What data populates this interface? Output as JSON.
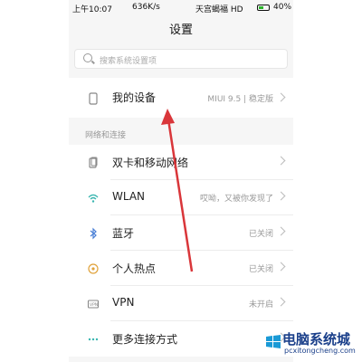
{
  "status_bar": {
    "time": "上午10:07",
    "speed": "636K/s",
    "carrier": "天宫蝎福 HD",
    "battery": "40%"
  },
  "header": {
    "title": "设置"
  },
  "search": {
    "placeholder": "搜索系统设置项"
  },
  "my_device": {
    "label": "我的设备",
    "value": "MIUI 9.5 | 稳定版"
  },
  "network_section": {
    "title": "网络和连接"
  },
  "rows": [
    {
      "label": "双卡和移动网络",
      "value": "",
      "icon": "sim-card-icon"
    },
    {
      "label": "WLAN",
      "value": "哎呦，又被你发现了",
      "icon": "wifi-icon"
    },
    {
      "label": "蓝牙",
      "value": "已关闭",
      "icon": "bluetooth-icon"
    },
    {
      "label": "个人热点",
      "value": "已关闭",
      "icon": "hotspot-icon"
    },
    {
      "label": "VPN",
      "value": "未开启",
      "icon": "vpn-icon"
    },
    {
      "label": "更多连接方式",
      "value": "",
      "icon": "more-dots-icon"
    }
  ],
  "watermark": {
    "title": "电脑系统城",
    "subtitle": "pcxitongcheng.com"
  },
  "accent": {
    "arrow": "#d9363a",
    "wifi": "#3ab6b0",
    "bluetooth": "#4a7fd6",
    "hotspot": "#e0a23a"
  }
}
